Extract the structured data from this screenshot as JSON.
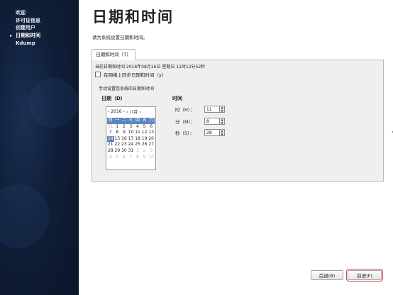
{
  "sidebar": {
    "items": [
      {
        "label": "欢迎",
        "current": false
      },
      {
        "label": "许可证信息",
        "current": false
      },
      {
        "label": "创建用户",
        "current": false
      },
      {
        "label": "日期和时间",
        "current": true
      },
      {
        "label": "Kdump",
        "current": false
      }
    ],
    "current_marker": "▸"
  },
  "page": {
    "title": "日期和时间",
    "subtitle": "请为系统设置日期和时间。"
  },
  "tab": {
    "label": "日期和时间（T）"
  },
  "panel": {
    "current_datetime": "当前日期和时间   2016年08月16日 星期日  11时12分52秒",
    "ntp_label": "在网络上同步日期和时间（y）",
    "ntp_checked": false,
    "manual_label": "手动设置您系统的日期和时间",
    "date_label": "日期（D）",
    "time_label": "时间"
  },
  "calendar": {
    "year_field": "‹ 2016 ›",
    "month_field": "‹ 八月 ›",
    "weekdays": [
      "日",
      "一",
      "二",
      "三",
      "四",
      "五",
      "六"
    ],
    "selected_day": "14",
    "weeks": [
      [
        {
          "d": "31",
          "dim": true
        },
        {
          "d": "1"
        },
        {
          "d": "2"
        },
        {
          "d": "3"
        },
        {
          "d": "4"
        },
        {
          "d": "5"
        },
        {
          "d": "6"
        }
      ],
      [
        {
          "d": "7"
        },
        {
          "d": "8"
        },
        {
          "d": "9"
        },
        {
          "d": "10"
        },
        {
          "d": "11"
        },
        {
          "d": "12"
        },
        {
          "d": "13"
        }
      ],
      [
        {
          "d": "14",
          "sel": true
        },
        {
          "d": "15"
        },
        {
          "d": "16"
        },
        {
          "d": "17"
        },
        {
          "d": "18"
        },
        {
          "d": "19"
        },
        {
          "d": "20"
        }
      ],
      [
        {
          "d": "21"
        },
        {
          "d": "22"
        },
        {
          "d": "23"
        },
        {
          "d": "24"
        },
        {
          "d": "25"
        },
        {
          "d": "26"
        },
        {
          "d": "27"
        }
      ],
      [
        {
          "d": "28"
        },
        {
          "d": "29"
        },
        {
          "d": "30"
        },
        {
          "d": "31"
        },
        {
          "d": "1",
          "dim": true
        },
        {
          "d": "2",
          "dim": true
        },
        {
          "d": "3",
          "dim": true
        }
      ],
      [
        {
          "d": "4",
          "dim": true
        },
        {
          "d": "5",
          "dim": true
        },
        {
          "d": "6",
          "dim": true
        },
        {
          "d": "7",
          "dim": true
        },
        {
          "d": "8",
          "dim": true
        },
        {
          "d": "9",
          "dim": true
        },
        {
          "d": "10",
          "dim": true
        }
      ]
    ]
  },
  "time": {
    "hour_label": "时（H）：",
    "hour_value": "11",
    "minute_label": "分（M）：",
    "minute_value": "8",
    "second_label": "秒（S）：",
    "second_value": "28"
  },
  "buttons": {
    "back": "后退(B)",
    "next": "前进(F)"
  },
  "colors": {
    "sidebar_bg": "#0f1e38",
    "calendar_accent": "#5f85be",
    "next_highlight": "#d04646"
  }
}
